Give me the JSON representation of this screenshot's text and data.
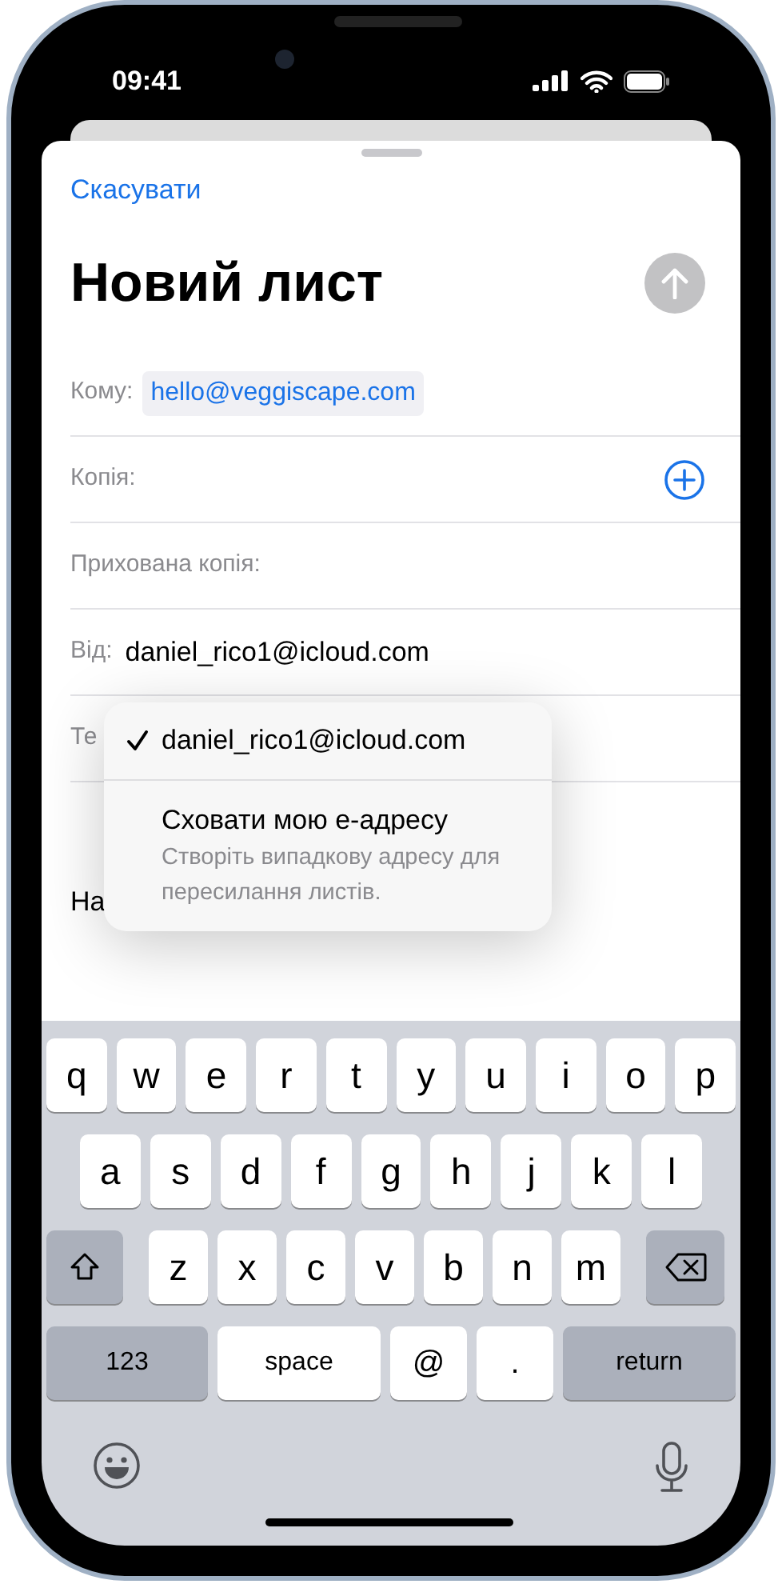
{
  "status_bar": {
    "time": "09:41"
  },
  "cancel": "Скасувати",
  "title": "Новий лист",
  "fields": [
    {
      "kind": "recipient",
      "label": "Кому:",
      "value": "hello@veggiscape.com"
    },
    {
      "kind": "add",
      "label": "Копія:"
    },
    {
      "kind": "plain",
      "label": "Прихована копія:"
    },
    {
      "kind": "from",
      "label": "Від:",
      "value": "daniel_rico1@icloud.com"
    },
    {
      "kind": "plain",
      "label": "Те"
    }
  ],
  "body_text": "На",
  "from_menu": [
    {
      "label": "daniel_rico1@icloud.com",
      "selected": true
    },
    {
      "label": "Сховати мою е-адресу",
      "description": "Створіть випадкову адресу для пересилання листів.",
      "selected": false
    }
  ],
  "keyboard": {
    "rows": [
      {
        "keys": [
          {
            "kind": "char",
            "label": "q"
          },
          {
            "kind": "char",
            "label": "w"
          },
          {
            "kind": "char",
            "label": "e"
          },
          {
            "kind": "char",
            "label": "r"
          },
          {
            "kind": "char",
            "label": "t"
          },
          {
            "kind": "char",
            "label": "y"
          },
          {
            "kind": "char",
            "label": "u"
          },
          {
            "kind": "char",
            "label": "i"
          },
          {
            "kind": "char",
            "label": "o"
          },
          {
            "kind": "char",
            "label": "p"
          }
        ]
      },
      {
        "keys": [
          {
            "kind": "char",
            "label": "a"
          },
          {
            "kind": "char",
            "label": "s"
          },
          {
            "kind": "char",
            "label": "d"
          },
          {
            "kind": "char",
            "label": "f"
          },
          {
            "kind": "char",
            "label": "g"
          },
          {
            "kind": "char",
            "label": "h"
          },
          {
            "kind": "char",
            "label": "j"
          },
          {
            "kind": "char",
            "label": "k"
          },
          {
            "kind": "char",
            "label": "l"
          }
        ]
      },
      {
        "keys": [
          {
            "kind": "shift"
          },
          {
            "kind": "char",
            "label": "z"
          },
          {
            "kind": "char",
            "label": "x"
          },
          {
            "kind": "char",
            "label": "c"
          },
          {
            "kind": "char",
            "label": "v"
          },
          {
            "kind": "char",
            "label": "b"
          },
          {
            "kind": "char",
            "label": "n"
          },
          {
            "kind": "char",
            "label": "m"
          },
          {
            "kind": "delete"
          }
        ]
      },
      {
        "keys": [
          {
            "kind": "mode",
            "label": "123"
          },
          {
            "kind": "space",
            "label": "space"
          },
          {
            "kind": "char",
            "label": "@"
          },
          {
            "kind": "char",
            "label": "."
          },
          {
            "kind": "return",
            "label": "return"
          }
        ]
      }
    ]
  }
}
